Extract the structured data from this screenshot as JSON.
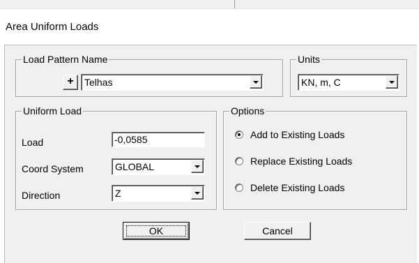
{
  "dialog": {
    "title": "Area Uniform Loads"
  },
  "load_pattern": {
    "legend": "Load Pattern Name",
    "add_label": "+",
    "value": "Telhas"
  },
  "units": {
    "legend": "Units",
    "value": "KN, m, C"
  },
  "uniform_load": {
    "legend": "Uniform Load",
    "load_label": "Load",
    "load_value": "-0,0585",
    "coord_label": "Coord System",
    "coord_value": "GLOBAL",
    "direction_label": "Direction",
    "direction_value": "Z"
  },
  "options": {
    "legend": "Options",
    "items": [
      {
        "label": "Add to Existing Loads",
        "selected": true
      },
      {
        "label": "Replace Existing Loads",
        "selected": false
      },
      {
        "label": "Delete Existing Loads",
        "selected": false
      }
    ]
  },
  "buttons": {
    "ok": "OK",
    "cancel": "Cancel"
  }
}
